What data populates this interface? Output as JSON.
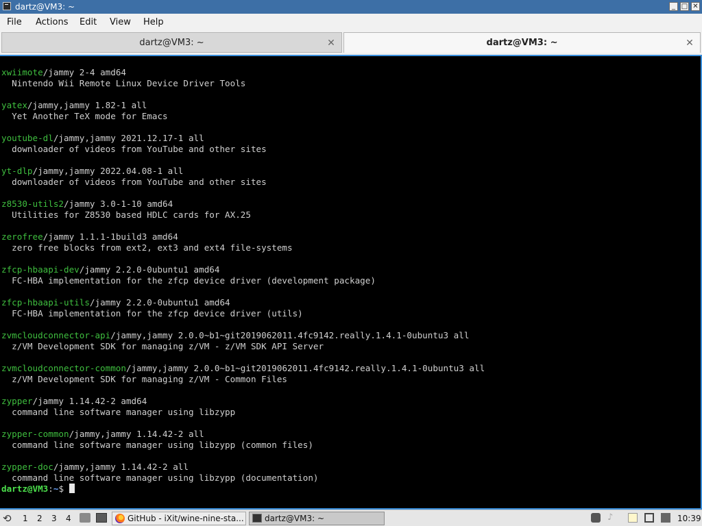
{
  "window": {
    "title": "dartz@VM3: ~",
    "min_label": "_",
    "max_label": "□",
    "close_label": "✕"
  },
  "menu": [
    "File",
    "Actions",
    "Edit",
    "View",
    "Help"
  ],
  "tabs": [
    {
      "label": "dartz@VM3: ~",
      "close": "✕"
    },
    {
      "label": "dartz@VM3: ~",
      "close": "✕"
    }
  ],
  "terminal": {
    "entries": [
      {
        "pkg": "xwiimote",
        "rest": "/jammy 2-4 amd64",
        "desc": "  Nintendo Wii Remote Linux Device Driver Tools"
      },
      {
        "pkg": "yatex",
        "rest": "/jammy,jammy 1.82-1 all",
        "desc": "  Yet Another TeX mode for Emacs"
      },
      {
        "pkg": "youtube-dl",
        "rest": "/jammy,jammy 2021.12.17-1 all",
        "desc": "  downloader of videos from YouTube and other sites"
      },
      {
        "pkg": "yt-dlp",
        "rest": "/jammy,jammy 2022.04.08-1 all",
        "desc": "  downloader of videos from YouTube and other sites"
      },
      {
        "pkg": "z8530-utils2",
        "rest": "/jammy 3.0-1-10 amd64",
        "desc": "  Utilities for Z8530 based HDLC cards for AX.25"
      },
      {
        "pkg": "zerofree",
        "rest": "/jammy 1.1.1-1build3 amd64",
        "desc": "  zero free blocks from ext2, ext3 and ext4 file-systems"
      },
      {
        "pkg": "zfcp-hbaapi-dev",
        "rest": "/jammy 2.2.0-0ubuntu1 amd64",
        "desc": "  FC-HBA implementation for the zfcp device driver (development package)"
      },
      {
        "pkg": "zfcp-hbaapi-utils",
        "rest": "/jammy 2.2.0-0ubuntu1 amd64",
        "desc": "  FC-HBA implementation for the zfcp device driver (utils)"
      },
      {
        "pkg": "zvmcloudconnector-api",
        "rest": "/jammy,jammy 2.0.0~b1~git2019062011.4fc9142.really.1.4.1-0ubuntu3 all",
        "desc": "  z/VM Development SDK for managing z/VM - z/VM SDK API Server"
      },
      {
        "pkg": "zvmcloudconnector-common",
        "rest": "/jammy,jammy 2.0.0~b1~git2019062011.4fc9142.really.1.4.1-0ubuntu3 all",
        "desc": "  z/VM Development SDK for managing z/VM - Common Files"
      },
      {
        "pkg": "zypper",
        "rest": "/jammy 1.14.42-2 amd64",
        "desc": "  command line software manager using libzypp"
      },
      {
        "pkg": "zypper-common",
        "rest": "/jammy,jammy 1.14.42-2 all",
        "desc": "  command line software manager using libzypp (common files)"
      },
      {
        "pkg": "zypper-doc",
        "rest": "/jammy,jammy 1.14.42-2 all",
        "desc": "  command line software manager using libzypp (documentation)"
      }
    ],
    "prompt": {
      "user": "dartz@VM3",
      "sep": ":",
      "path": "~",
      "symbol": "$ "
    }
  },
  "taskbar": {
    "workspaces": [
      "1",
      "2",
      "3",
      "4"
    ],
    "tasks": [
      {
        "label": "GitHub - iXit/wine-nine-sta...",
        "icon": "firefox-icon"
      },
      {
        "label": "dartz@VM3: ~",
        "icon": "terminal-icon"
      }
    ],
    "clock": "10:39"
  },
  "colors": {
    "titlebar": "#3d6fa6",
    "package_name": "#3fbf3f",
    "prompt_user": "#4ce04c",
    "prompt_path": "#6aa5ff",
    "accent": "#3a8fdc"
  }
}
